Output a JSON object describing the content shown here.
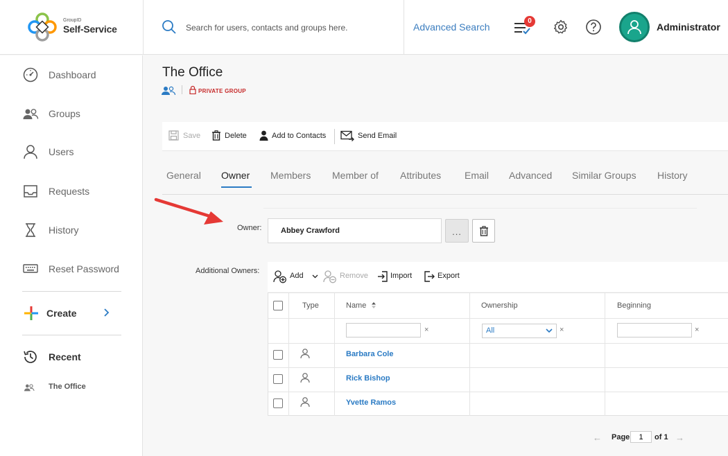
{
  "header": {
    "logo_small": "GroupID",
    "logo_big": "Self-Service",
    "search_placeholder": "Search for users, contacts and groups here.",
    "advanced_search": "Advanced Search",
    "notification_count": "0",
    "username": "Administrator"
  },
  "sidebar": {
    "items": [
      {
        "label": "Dashboard",
        "icon": "dashboard-icon"
      },
      {
        "label": "Groups",
        "icon": "groups-icon"
      },
      {
        "label": "Users",
        "icon": "user-icon"
      },
      {
        "label": "Requests",
        "icon": "inbox-icon"
      },
      {
        "label": "History",
        "icon": "hourglass-icon"
      },
      {
        "label": "Reset Password",
        "icon": "keyboard-icon"
      }
    ],
    "create_label": "Create",
    "recent_label": "Recent",
    "recent_items": [
      {
        "label": "The Office",
        "icon": "groups-icon"
      }
    ]
  },
  "page": {
    "title": "The Office",
    "group_type": "PRIVATE GROUP"
  },
  "toolbar": {
    "save": "Save",
    "delete": "Delete",
    "add_to_contacts": "Add to Contacts",
    "send_email": "Send Email"
  },
  "tabs": [
    "General",
    "Owner",
    "Members",
    "Member of",
    "Attributes",
    "Email",
    "Advanced",
    "Similar Groups",
    "History"
  ],
  "active_tab": "Owner",
  "owner": {
    "label": "Owner:",
    "value": "Abbey Crawford",
    "browse_label": "..."
  },
  "additional_owners": {
    "label": "Additional Owners:",
    "add": "Add",
    "remove": "Remove",
    "import": "Import",
    "export": "Export",
    "columns": [
      "Type",
      "Name",
      "Ownership",
      "Beginning"
    ],
    "ownership_filter": "All",
    "filter_clear": "×",
    "rows": [
      {
        "name": "Barbara Cole"
      },
      {
        "name": "Rick Bishop"
      },
      {
        "name": "Yvette Ramos"
      }
    ]
  },
  "pager": {
    "prev": "←",
    "page_label": "Page",
    "page_value": "1",
    "of_label": "of 1",
    "next": "→"
  },
  "colors": {
    "accent": "#2b7bc4",
    "avatar": "#1aa58c",
    "badge": "#e53935",
    "private": "#c62828",
    "arrow": "#e53935"
  }
}
